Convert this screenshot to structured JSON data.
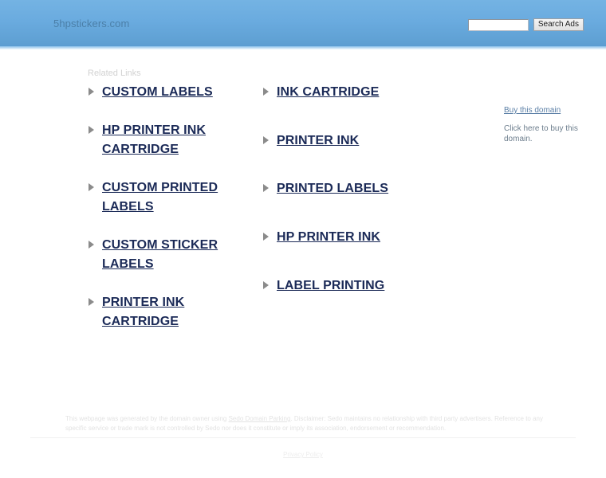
{
  "header": {
    "logo": "5hpstickers.com",
    "search": {
      "value": "",
      "placeholder": "",
      "button_label": "Search Ads"
    },
    "background_top_color": "#74b3e3",
    "background_bottom_color": "#5c9dd1"
  },
  "main": {
    "related_links_label": "Related Links",
    "link_color": "#1b2a57",
    "columns": [
      {
        "name": "left",
        "links": [
          {
            "label": "CUSTOM LABELS"
          },
          {
            "label": "HP PRINTER INK CARTRIDGE"
          },
          {
            "label": "CUSTOM PRINTED LABELS"
          },
          {
            "label": "CUSTOM STICKER LABELS"
          },
          {
            "label": "PRINTER INK CARTRIDGE"
          }
        ]
      },
      {
        "name": "right",
        "links": [
          {
            "label": "INK CARTRIDGE"
          },
          {
            "label": "PRINTER INK"
          },
          {
            "label": "PRINTED LABELS"
          },
          {
            "label": "HP PRINTER INK"
          },
          {
            "label": "LABEL PRINTING"
          }
        ]
      }
    ]
  },
  "sidebar": {
    "buy_link_label": "Buy this domain",
    "buy_description": "Click here to buy this domain."
  },
  "footer": {
    "disclaimer_part1": "This webpage was generated by the domain owner using ",
    "sedo_link_label": "Sedo Domain Parking",
    "disclaimer_part2": ". Disclaimer: Sedo maintains no relationship with third party advertisers. Reference to any specific service or trade mark is not controlled by Sedo nor does it constitute or imply its association, endorsement or recommendation.",
    "privacy_policy_label": "Privacy Policy"
  }
}
